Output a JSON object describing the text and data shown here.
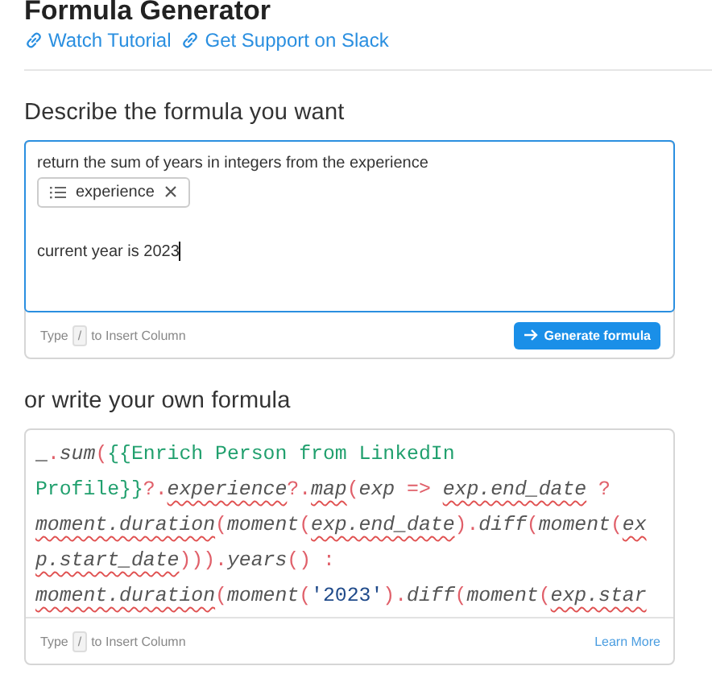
{
  "title": "Formula Generator",
  "links": [
    "Watch Tutorial",
    "Get Support on Slack"
  ],
  "describe": {
    "heading": "Describe the formula you want",
    "items": [
      {
        "kind": "text",
        "text": "return the sum of years in integers from the experience",
        "caret": false
      },
      {
        "kind": "chip",
        "text": "experience"
      },
      {
        "kind": "text",
        "text": "current year is 2023",
        "caret": true
      }
    ],
    "hint": [
      "Type",
      "/",
      "to Insert Column"
    ],
    "button": "Generate formula"
  },
  "own": {
    "heading": "or write your own formula",
    "lines": [
      [
        {
          "kind": "plain",
          "text": "_"
        },
        {
          "kind": "punct",
          "text": "."
        },
        {
          "kind": "method",
          "text": "sum"
        },
        {
          "kind": "punct",
          "text": "("
        },
        {
          "kind": "template",
          "text": "{{Enrich Person from LinkedIn"
        }
      ],
      [
        {
          "kind": "template",
          "text": "Profile}}"
        },
        {
          "kind": "punct",
          "text": "?."
        },
        {
          "kind": "method",
          "text": "experience",
          "squiggle": true
        },
        {
          "kind": "punct",
          "text": "?."
        },
        {
          "kind": "method",
          "text": "map",
          "squiggle": true
        },
        {
          "kind": "punct",
          "text": "("
        },
        {
          "kind": "method",
          "text": "exp"
        },
        {
          "kind": "punct",
          "text": " => "
        },
        {
          "kind": "method",
          "text": "exp.end_date",
          "squiggle": true
        },
        {
          "kind": "punct",
          "text": " ?"
        }
      ],
      [
        {
          "kind": "method",
          "text": "moment.duration",
          "squiggle": true
        },
        {
          "kind": "punct",
          "text": "("
        },
        {
          "kind": "method",
          "text": "moment"
        },
        {
          "kind": "punct",
          "text": "("
        },
        {
          "kind": "method",
          "text": "exp.end_date",
          "squiggle": true
        },
        {
          "kind": "punct",
          "text": ")."
        },
        {
          "kind": "method",
          "text": "diff"
        },
        {
          "kind": "punct",
          "text": "("
        },
        {
          "kind": "method",
          "text": "moment"
        },
        {
          "kind": "punct",
          "text": "("
        },
        {
          "kind": "method",
          "text": "ex",
          "squiggle": true
        }
      ],
      [
        {
          "kind": "method",
          "text": "p.start_date",
          "squiggle": true
        },
        {
          "kind": "punct",
          "text": ")))."
        },
        {
          "kind": "method",
          "text": "years"
        },
        {
          "kind": "punct",
          "text": "() :"
        }
      ],
      [
        {
          "kind": "method",
          "text": "moment.duration",
          "squiggle": true
        },
        {
          "kind": "punct",
          "text": "("
        },
        {
          "kind": "method",
          "text": "moment"
        },
        {
          "kind": "punct",
          "text": "("
        },
        {
          "kind": "string",
          "text": "'2023'"
        },
        {
          "kind": "punct",
          "text": ")."
        },
        {
          "kind": "method",
          "text": "diff"
        },
        {
          "kind": "punct",
          "text": "("
        },
        {
          "kind": "method",
          "text": "moment"
        },
        {
          "kind": "punct",
          "text": "("
        },
        {
          "kind": "method",
          "text": "exp.star",
          "squiggle": true
        }
      ]
    ],
    "hint": [
      "Type",
      "/",
      "to Insert Column"
    ],
    "link": "Learn More"
  }
}
